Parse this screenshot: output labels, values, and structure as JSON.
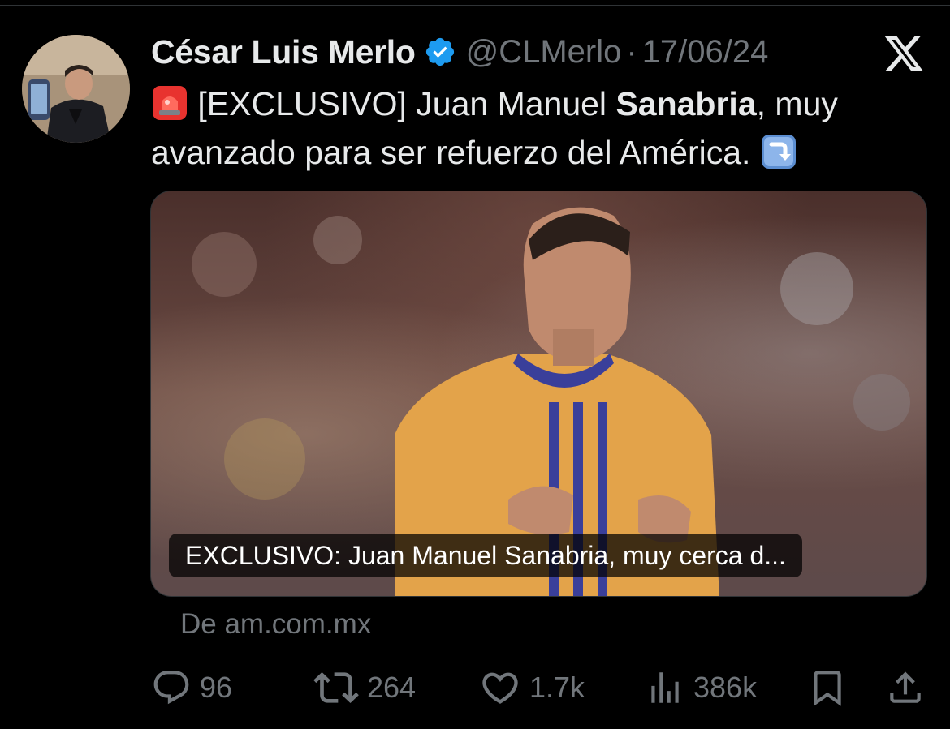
{
  "tweet": {
    "author": {
      "display_name": "César Luis Merlo",
      "handle": "@CLMerlo",
      "verified": true
    },
    "separator": "·",
    "date": "17/06/24",
    "text": {
      "emoji_start": "rotating-light-emoji",
      "part1": "[EXCLUSIVO] Juan Manuel ",
      "bold": "Sanabria",
      "part2": ", muy avanzado para ser refuerzo del América. ",
      "emoji_end": "arrow-down-right-emoji"
    },
    "card": {
      "title": "EXCLUSIVO: Juan Manuel Sanabria, muy cerca d...",
      "source": "De am.com.mx"
    },
    "actions": {
      "replies": "96",
      "reposts": "264",
      "likes": "1.7k",
      "views": "386k"
    }
  },
  "colors": {
    "background": "#000000",
    "text_primary": "#e7e9ea",
    "text_secondary": "#71767b",
    "verified_blue": "#1d9bf0"
  },
  "icons": {
    "platform": "x-logo",
    "reply": "reply-icon",
    "repost": "repost-icon",
    "like": "heart-icon",
    "views": "views-icon",
    "bookmark": "bookmark-icon",
    "share": "share-icon"
  }
}
